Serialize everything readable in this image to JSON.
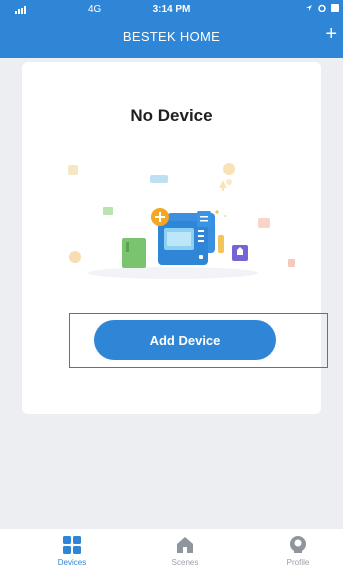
{
  "status_bar": {
    "network": "4G",
    "time": "3:14 PM"
  },
  "header": {
    "title": "BESTEK HOME",
    "add_icon": "plus-icon"
  },
  "empty_state": {
    "message": "No Device",
    "button_label": "Add Device"
  },
  "bottom_nav": {
    "items": [
      {
        "label": "Devices",
        "icon": "devices-grid-icon",
        "active": true
      },
      {
        "label": "Scenes",
        "icon": "home-icon",
        "active": false
      },
      {
        "label": "Profile",
        "icon": "profile-icon",
        "active": false
      }
    ]
  },
  "colors": {
    "primary": "#2f86d6",
    "background": "#eceef2",
    "highlight": "#e0403a"
  }
}
